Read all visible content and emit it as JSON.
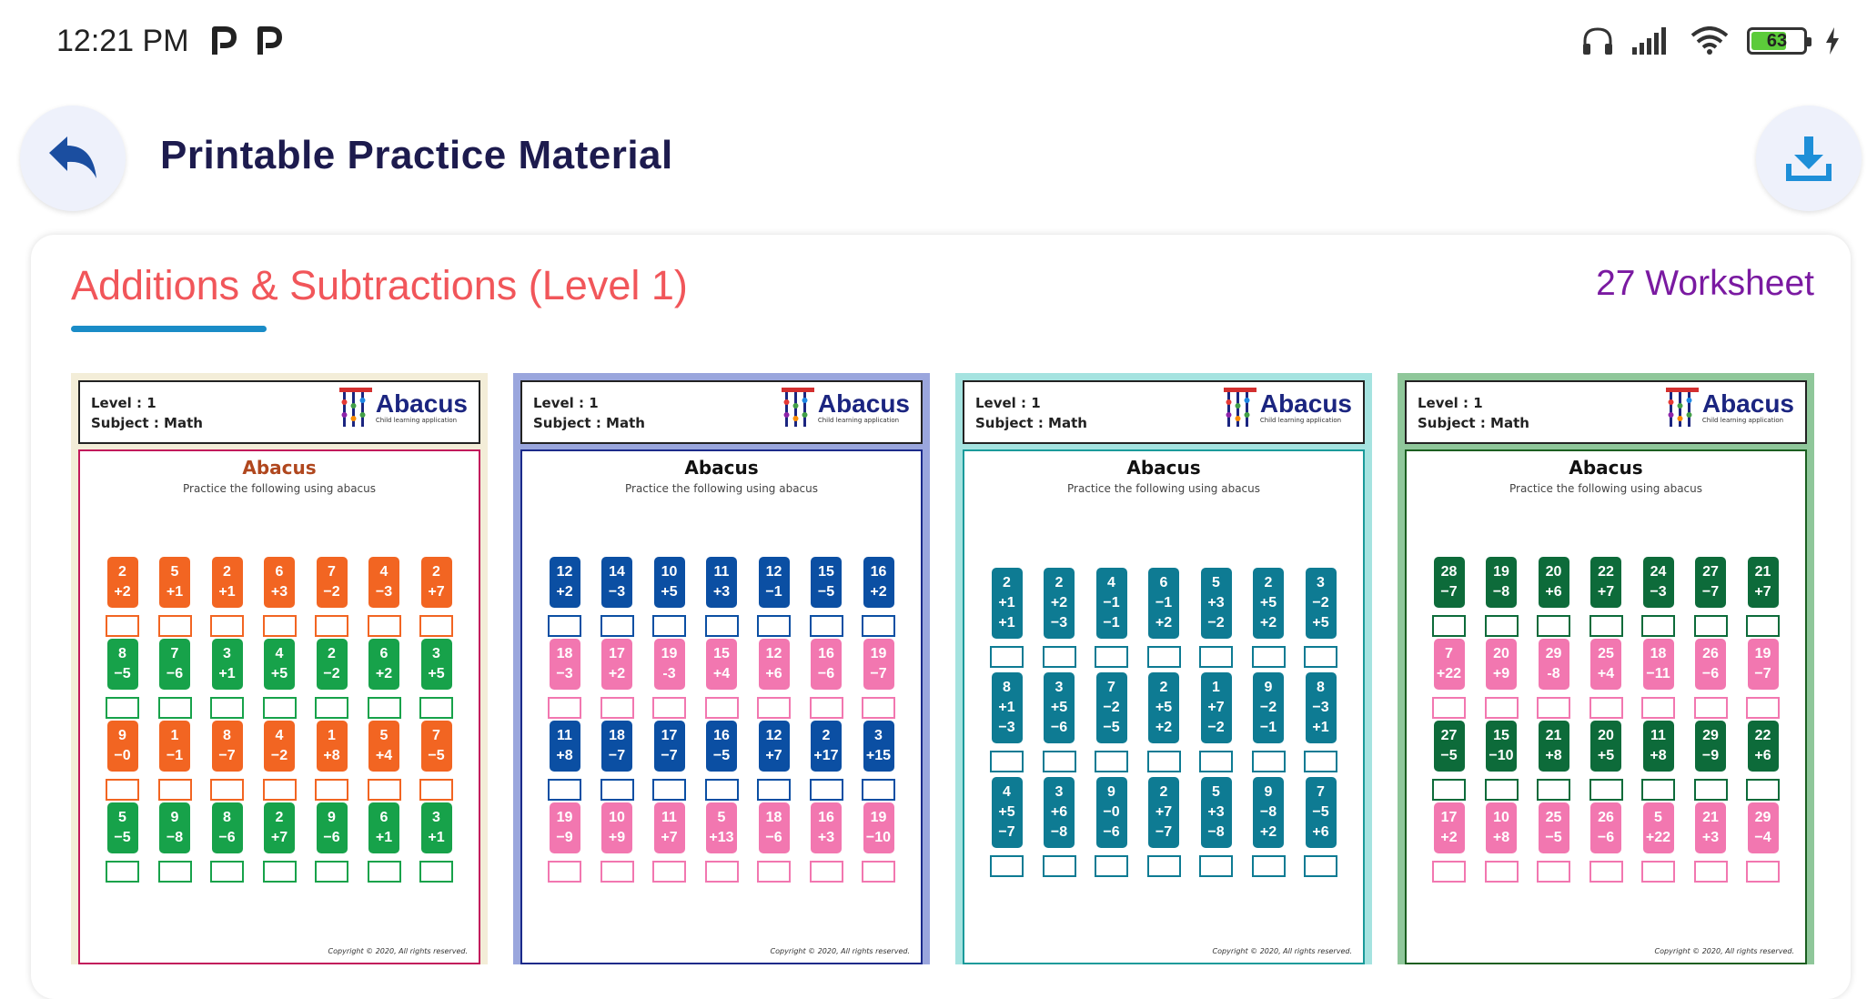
{
  "status_bar": {
    "time": "12:21 PM",
    "notif_icons": [
      "p-icon",
      "p-icon"
    ],
    "battery": "63",
    "battery_level": 0.63
  },
  "header": {
    "back_icon": "undo-arrow-icon",
    "title": "Printable Practice Material",
    "download_icon": "download-icon"
  },
  "section": {
    "title": "Additions & Subtractions (Level 1)",
    "count": "27 Worksheet"
  },
  "worksheet_common": {
    "level": "Level : 1",
    "subject": "Subject : Math",
    "logo_text": "Abacus",
    "logo_tag": "Child learning application",
    "heading": "Abacus",
    "instruction": "Practice the following using abacus",
    "copyright": "Copyright © 2020, All rights reserved."
  },
  "worksheets": [
    {
      "frame_color": "#f3edd8",
      "body_border": "#c2185b",
      "heading_color": "#b0471e",
      "rows": [
        {
          "color": "#f26522",
          "items": [
            "2\n+2",
            "5\n+1",
            "2\n+1",
            "6\n+3",
            "7\n−2",
            "4\n−3",
            "2\n+7"
          ]
        },
        {
          "color": "#17a24a",
          "items": [
            "8\n−5",
            "7\n−6",
            "3\n+1",
            "4\n+5",
            "2\n−2",
            "6\n+2",
            "3\n+5"
          ]
        },
        {
          "color": "#f26522",
          "items": [
            "9\n−0",
            "1\n−1",
            "8\n−7",
            "4\n−2",
            "1\n+8",
            "5\n+4",
            "7\n−5"
          ]
        },
        {
          "color": "#17a24a",
          "items": [
            "5\n−5",
            "9\n−8",
            "8\n−6",
            "2\n+7",
            "9\n−6",
            "6\n+1",
            "3\n+1"
          ]
        }
      ]
    },
    {
      "frame_color": "#9aa6dd",
      "body_border": "#1b2a8a",
      "heading_color": "#111111",
      "rows": [
        {
          "color": "#0b4fa3",
          "items": [
            "12\n+2",
            "14\n−3",
            "10\n+5",
            "11\n+3",
            "12\n−1",
            "15\n−5",
            "16\n+2"
          ]
        },
        {
          "color": "#f277b0",
          "items": [
            "18\n−3",
            "17\n+2",
            "19\n-3",
            "15\n+4",
            "12\n+6",
            "16\n−6",
            "19\n−7"
          ]
        },
        {
          "color": "#0b4fa3",
          "items": [
            "11\n+8",
            "18\n−7",
            "17\n−7",
            "16\n−5",
            "12\n+7",
            "2\n+17",
            "3\n+15"
          ]
        },
        {
          "color": "#f277b0",
          "items": [
            "19\n−9",
            "10\n+9",
            "11\n+7",
            "5\n+13",
            "18\n−6",
            "16\n+3",
            "19\n−10"
          ]
        }
      ]
    },
    {
      "frame_color": "#a5e3e0",
      "body_border": "#1a9a9a",
      "heading_color": "#111111",
      "rows": [
        {
          "color": "#0e7b93",
          "items": [
            "2\n+1\n+1",
            "2\n+2\n−3",
            "4\n−1\n−1",
            "6\n−1\n+2",
            "5\n+3\n−2",
            "2\n+5\n+2",
            "3\n−2\n+5"
          ]
        },
        {
          "color": "#0e7b93",
          "items": [
            "8\n+1\n−3",
            "3\n+5\n−6",
            "7\n−2\n−5",
            "2\n+5\n+2",
            "1\n+7\n−2",
            "9\n−2\n−1",
            "8\n−3\n+1"
          ]
        },
        {
          "color": "#0e7b93",
          "items": [
            "4\n+5\n−7",
            "3\n+6\n−8",
            "9\n−0\n−6",
            "2\n+7\n−7",
            "5\n+3\n−8",
            "9\n−8\n+2",
            "7\n−5\n+6"
          ]
        }
      ]
    },
    {
      "frame_color": "#8fc79a",
      "body_border": "#1b5e20",
      "heading_color": "#111111",
      "rows": [
        {
          "color": "#0d6b3a",
          "items": [
            "28\n−7",
            "19\n−8",
            "20\n+6",
            "22\n+7",
            "24\n−3",
            "27\n−7",
            "21\n+7"
          ]
        },
        {
          "color": "#f277b0",
          "items": [
            "7\n+22",
            "20\n+9",
            "29\n-8",
            "25\n+4",
            "18\n−11",
            "26\n−6",
            "19\n−7"
          ]
        },
        {
          "color": "#0d6b3a",
          "items": [
            "27\n−5",
            "15\n−10",
            "21\n+8",
            "20\n+5",
            "11\n+8",
            "29\n−9",
            "22\n+6"
          ]
        },
        {
          "color": "#f277b0",
          "items": [
            "17\n+2",
            "10\n+8",
            "25\n−5",
            "26\n−6",
            "5\n+22",
            "21\n+3",
            "29\n−4"
          ]
        }
      ]
    }
  ]
}
